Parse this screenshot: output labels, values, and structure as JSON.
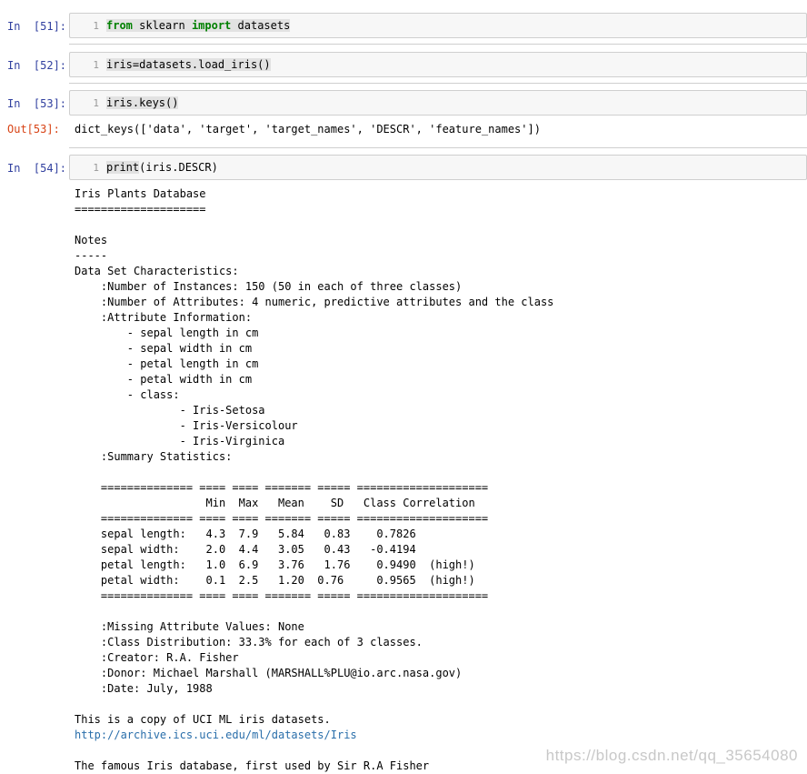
{
  "cells": [
    {
      "prompt": "In  [51]:",
      "line": "1",
      "code_pre": "",
      "kw1": "from",
      "mid": " sklearn ",
      "kw2": "import",
      "post": " datasets"
    },
    {
      "prompt": "In  [52]:",
      "line": "1",
      "code": "iris=datasets.load_iris()"
    },
    {
      "prompt": "In  [53]:",
      "line": "1",
      "code": "iris.keys()"
    },
    {
      "prompt": "In  [54]:",
      "line": "1",
      "code_hl": "print",
      "code_rest": "(iris.DESCR)"
    }
  ],
  "out53": {
    "prompt": "Out[53]:",
    "text": "dict_keys(['data', 'target', 'target_names', 'DESCR', 'feature_names'])"
  },
  "output54": {
    "block1": "Iris Plants Database\n====================\n\nNotes\n-----\nData Set Characteristics:\n    :Number of Instances: 150 (50 in each of three classes)\n    :Number of Attributes: 4 numeric, predictive attributes and the class\n    :Attribute Information:\n        - sepal length in cm\n        - sepal width in cm\n        - petal length in cm\n        - petal width in cm\n        - class:\n                - Iris-Setosa\n                - Iris-Versicolour\n                - Iris-Virginica\n    :Summary Statistics:\n\n    ============== ==== ==== ======= ===== ====================\n                    Min  Max   Mean    SD   Class Correlation\n    ============== ==== ==== ======= ===== ====================\n    sepal length:   4.3  7.9   5.84   0.83    0.7826\n    sepal width:    2.0  4.4   3.05   0.43   -0.4194\n    petal length:   1.0  6.9   3.76   1.76    0.9490  (high!)\n    petal width:    0.1  2.5   1.20  0.76     0.9565  (high!)\n    ============== ==== ==== ======= ===== ====================\n\n    :Missing Attribute Values: None\n    :Class Distribution: 33.3% for each of 3 classes.\n    :Creator: R.A. Fisher\n    :Donor: Michael Marshall (MARSHALL%PLU@io.arc.nasa.gov)\n    :Date: July, 1988\n\nThis is a copy of UCI ML iris datasets.",
    "link": "http://archive.ics.uci.edu/ml/datasets/Iris",
    "block2": "The famous Iris database, first used by Sir R.A Fisher"
  },
  "watermark": "https://blog.csdn.net/qq_35654080"
}
